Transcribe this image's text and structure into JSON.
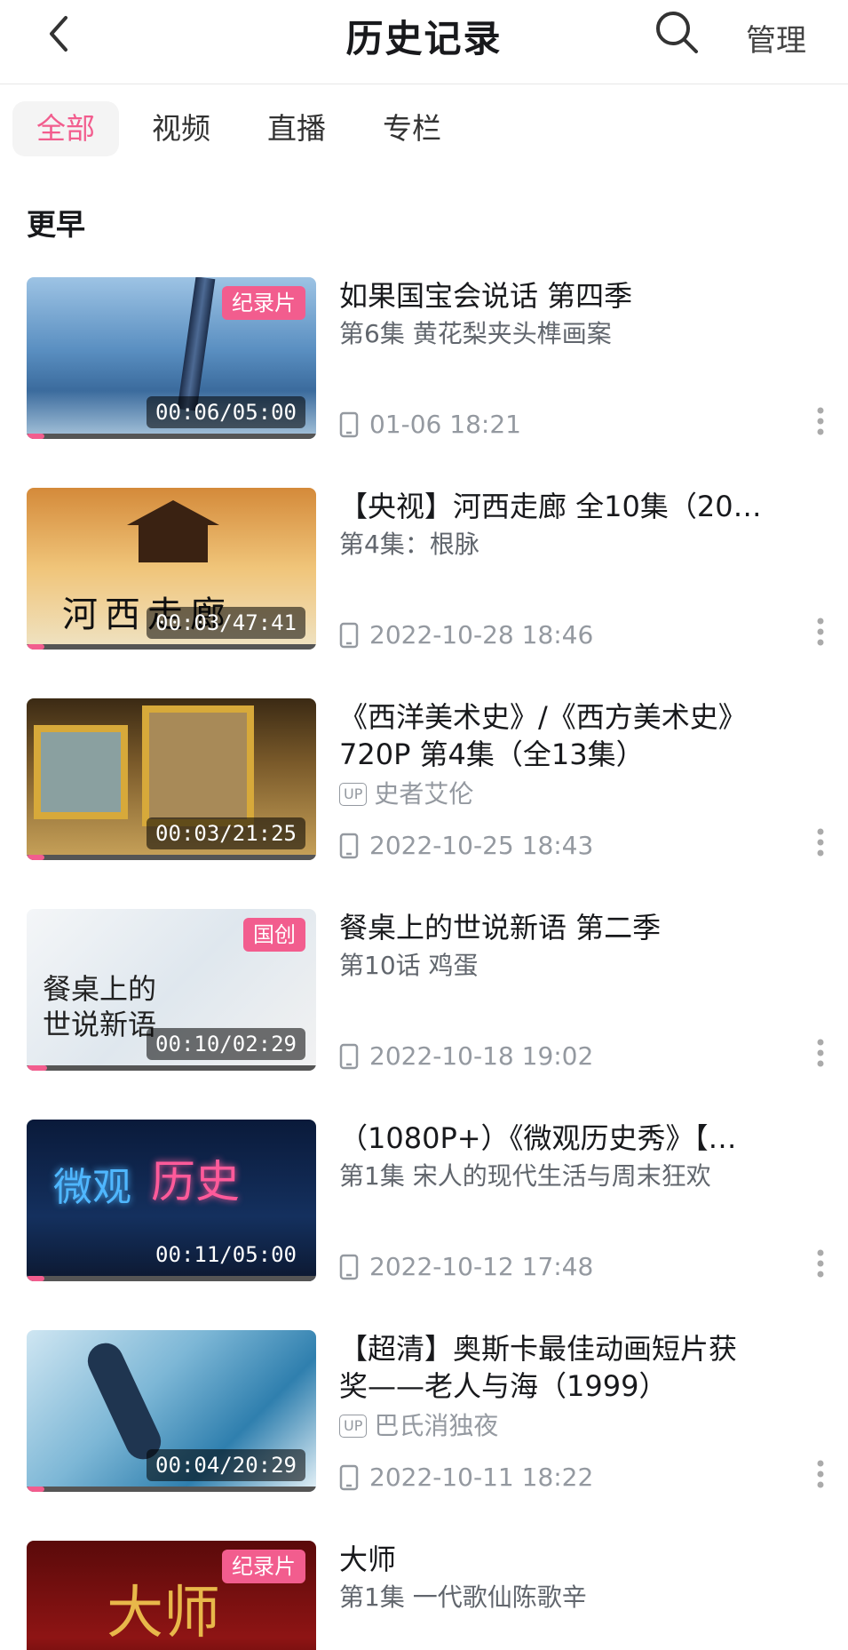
{
  "header": {
    "title": "历史记录",
    "manage": "管理"
  },
  "tabs": [
    {
      "label": "全部"
    },
    {
      "label": "视频"
    },
    {
      "label": "直播"
    },
    {
      "label": "专栏"
    }
  ],
  "section_label": "更早",
  "items": [
    {
      "title_line1": "如果国宝会说话 第四季",
      "title_line2": "",
      "subtitle": "第6集 黄花梨夹头榫画案",
      "up": "",
      "time": "01-06 18:21",
      "duration": "00:06/05:00",
      "tag": "纪录片",
      "progress": 0.06
    },
    {
      "title_line1": "【央视】河西走廊 全10集（20…",
      "title_line2": "",
      "subtitle": "第4集：根脉",
      "up": "",
      "time": "2022-10-28 18:46",
      "duration": "00:03/47:41",
      "tag": "",
      "progress": 0.06
    },
    {
      "title_line1": "《西洋美术史》/《西方美术史》",
      "title_line2": "720P 第4集（全13集）",
      "subtitle": "",
      "up": "史者艾伦",
      "time": "2022-10-25 18:43",
      "duration": "00:03/21:25",
      "tag": "",
      "progress": 0.06
    },
    {
      "title_line1": "餐桌上的世说新语  第二季",
      "title_line2": "",
      "subtitle": "第10话 鸡蛋",
      "up": "",
      "time": "2022-10-18 19:02",
      "duration": "00:10/02:29",
      "tag": "国创",
      "progress": 0.07
    },
    {
      "title_line1": "（1080P+）《微观历史秀》【…",
      "title_line2": "",
      "subtitle": "第1集 宋人的现代生活与周末狂欢",
      "up": "",
      "time": "2022-10-12 17:48",
      "duration": "00:11/05:00",
      "tag": "",
      "progress": 0.06
    },
    {
      "title_line1": "【超清】奥斯卡最佳动画短片获",
      "title_line2": "奖——老人与海（1999）",
      "subtitle": "",
      "up": "巴氏消独夜",
      "time": "2022-10-11 18:22",
      "duration": "00:04/20:29",
      "tag": "",
      "progress": 0.06
    },
    {
      "title_line1": "大师",
      "title_line2": "",
      "subtitle": "第1集 一代歌仙陈歌辛",
      "up": "",
      "time": "",
      "duration": "",
      "tag": "纪录片",
      "progress": 0.06
    }
  ],
  "colors": {
    "accent": "#f25d8e",
    "meta_gray": "#9499a0"
  }
}
